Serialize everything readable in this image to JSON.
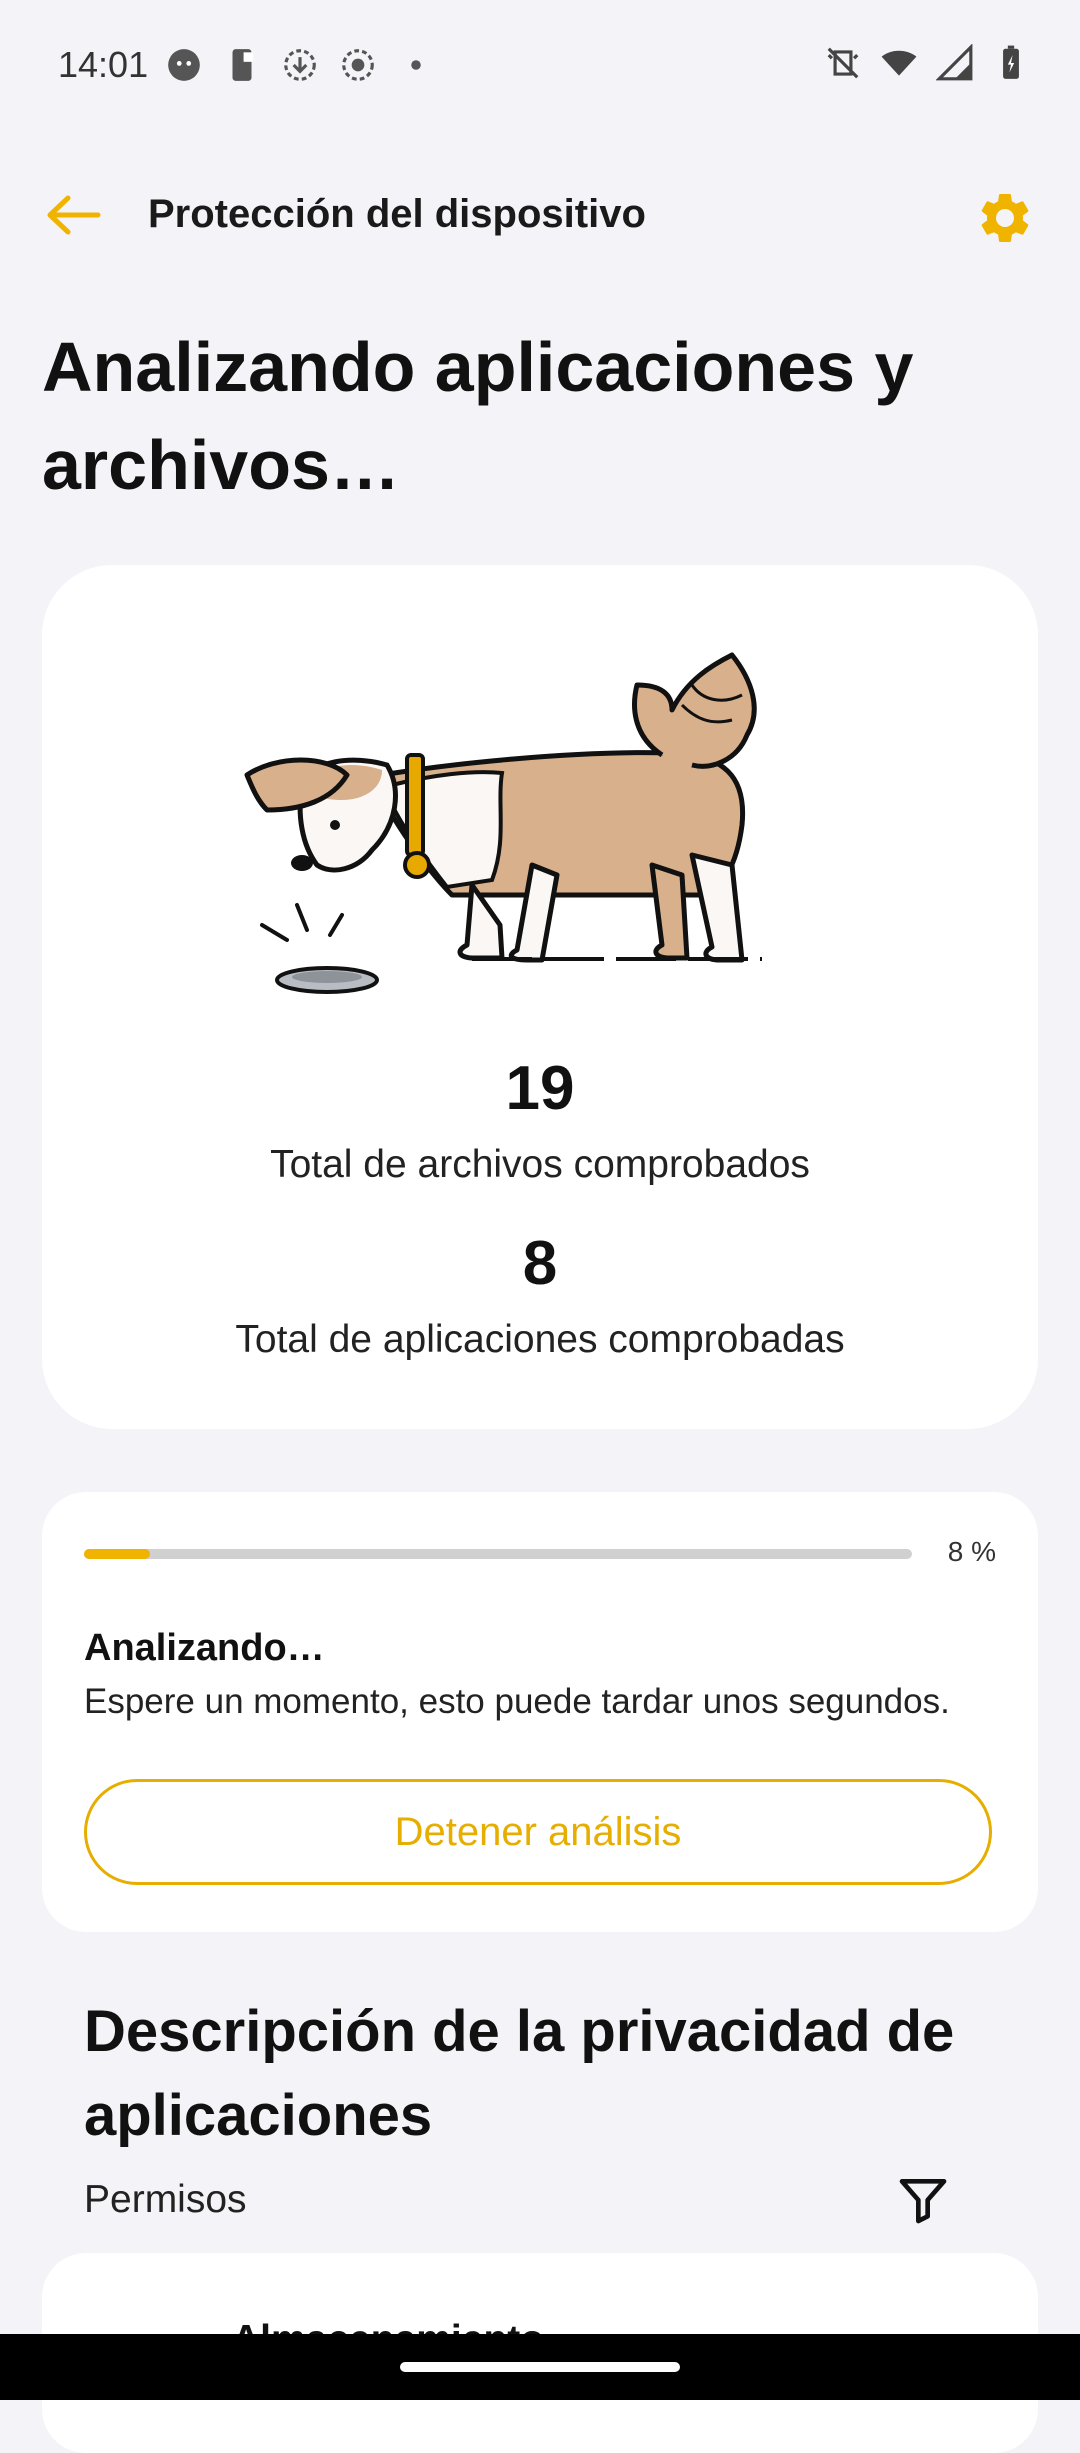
{
  "status_bar": {
    "time": "14:01",
    "left_icons": [
      "face-icon",
      "phone-icon",
      "download-icon",
      "record-icon",
      "dot-icon"
    ],
    "right_icons": [
      "vibrate-off-icon",
      "wifi-icon",
      "signal-icon",
      "battery-icon"
    ]
  },
  "app_bar": {
    "title": "Protección del dispositivo",
    "back_icon": "arrow-left-icon",
    "settings_icon": "gear-icon"
  },
  "headline": "Analizando aplicaciones y archivos…",
  "stats": {
    "files_count": "19",
    "files_label": "Total de archivos comprobados",
    "apps_count": "8",
    "apps_label": "Total de aplicaciones comprobadas"
  },
  "scan": {
    "progress_percent": 8,
    "progress_label": "8 %",
    "title": "Analizando…",
    "description": "Espere un momento, esto puede tardar unos segundos.",
    "stop_button": "Detener análisis"
  },
  "privacy": {
    "title": "Descripción de la privacidad de aplicaciones",
    "subtitle": "Permisos",
    "filter_icon": "filter-icon",
    "first_item": "Almacenamiento"
  },
  "colors": {
    "accent": "#F0B400",
    "background": "#F4F3F7",
    "card": "#FFFFFF"
  }
}
